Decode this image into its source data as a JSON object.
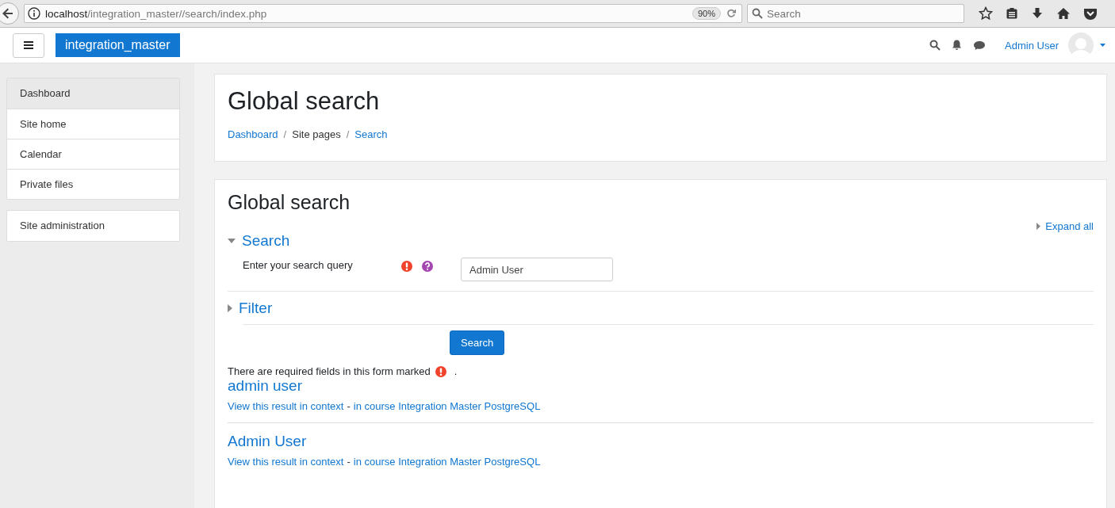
{
  "browser": {
    "url_host": "localhost",
    "url_path": "/integration_master//search/index.php",
    "zoom": "90%",
    "search_placeholder": "Search"
  },
  "navbar": {
    "site_name": "integration_master",
    "user_name": "Admin User"
  },
  "sidebar": {
    "groups": [
      [
        {
          "label": "Dashboard",
          "selected": true
        },
        {
          "label": "Site home",
          "selected": false
        },
        {
          "label": "Calendar",
          "selected": false
        },
        {
          "label": "Private files",
          "selected": false
        }
      ],
      [
        {
          "label": "Site administration",
          "selected": false
        }
      ]
    ]
  },
  "header": {
    "title": "Global search",
    "breadcrumbs": [
      {
        "label": "Dashboard",
        "kind": "link"
      },
      {
        "label": "Site pages",
        "kind": "text"
      },
      {
        "label": "Search",
        "kind": "link"
      }
    ],
    "separator": "/"
  },
  "form": {
    "title": "Global search",
    "expand_all": "Expand all",
    "sections": [
      {
        "title": "Search",
        "expanded": true,
        "field_label": "Enter your search query",
        "value": "Admin User"
      },
      {
        "title": "Filter",
        "expanded": false
      }
    ],
    "submit": "Search",
    "required_note": "There are required fields in this form marked",
    "required_note_end": "."
  },
  "results": [
    {
      "title": "admin user",
      "context_link": "View this result in context",
      "separator": "-",
      "course_link": "in course Integration Master PostgreSQL"
    },
    {
      "title": "Admin User",
      "context_link": "View this result in context",
      "separator": "-",
      "course_link": "in course Integration Master PostgreSQL"
    }
  ]
}
